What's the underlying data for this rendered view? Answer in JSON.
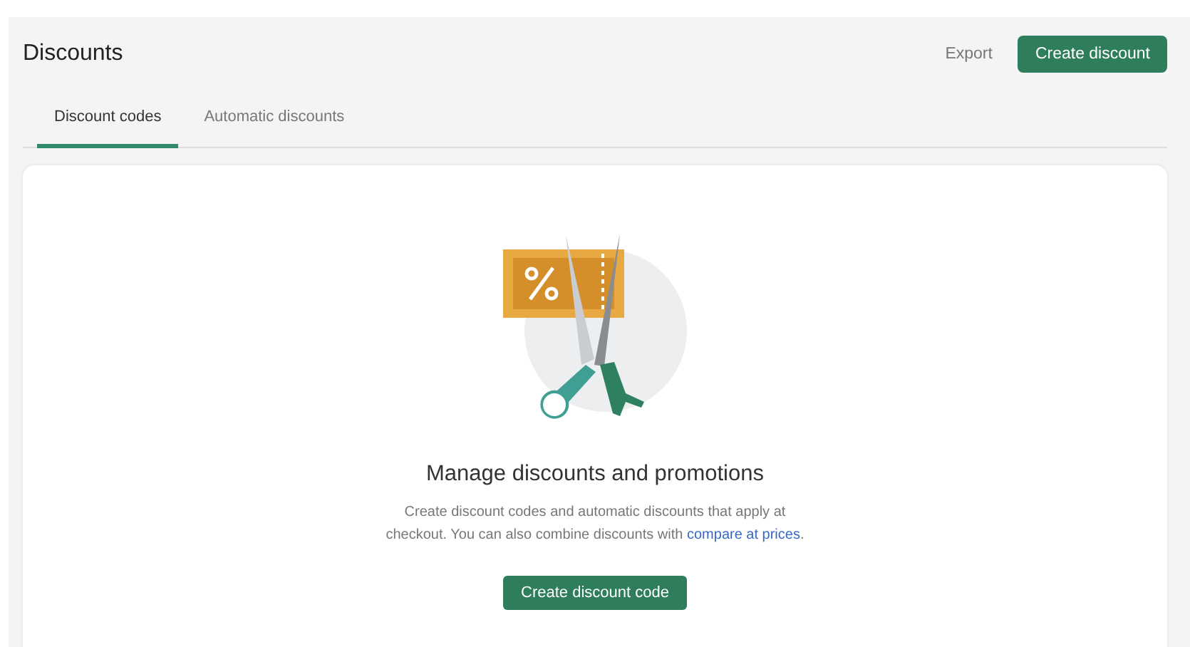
{
  "page": {
    "title": "Discounts"
  },
  "header_actions": [
    {
      "kind": "plain",
      "label": "Export"
    },
    {
      "kind": "primary",
      "label": "Create discount"
    }
  ],
  "tabs": [
    {
      "label": "Discount codes",
      "selected": true
    },
    {
      "label": "Automatic discounts",
      "selected": false
    }
  ],
  "empty_state": {
    "heading": "Manage discounts and promotions",
    "description": "Create discount codes and automatic discounts that apply at checkout. You can also combine discounts with ",
    "link": "compare at prices",
    "description_end": ".",
    "button": "Create discount code"
  }
}
